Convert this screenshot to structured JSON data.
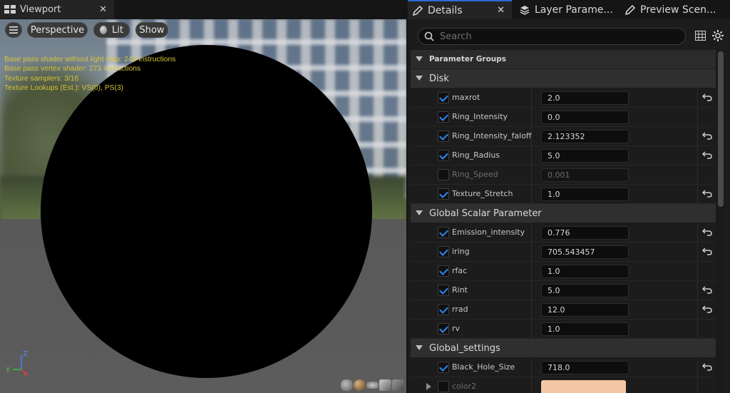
{
  "viewport": {
    "tab_label": "Viewport",
    "close_glyph": "✕",
    "toolbar": {
      "perspective_label": "Perspective",
      "lit_label": "Lit",
      "show_label": "Show"
    },
    "stats": [
      "Base pass shader without light map: 243 instructions",
      "Base pass vertex shader: 273 instructions",
      "Texture samplers: 3/16",
      "Texture Lookups (Est.): VS(0), PS(3)"
    ],
    "axis": {
      "z": "Z",
      "y": "Y",
      "x": "X"
    }
  },
  "details": {
    "tabs": [
      {
        "label": "Details",
        "active": true
      },
      {
        "label": "Layer Parame...",
        "active": false
      },
      {
        "label": "Preview Scen...",
        "active": false
      }
    ],
    "close_glyph": "✕",
    "search_placeholder": "Search",
    "header": "Parameter Groups",
    "groups": [
      {
        "name": "Disk",
        "params": [
          {
            "name": "maxrot",
            "value": "2.0",
            "checked": true,
            "reset": true
          },
          {
            "name": "Ring_Intensity",
            "value": "0.0",
            "checked": true,
            "reset": false
          },
          {
            "name": "Ring_Intensity_faloff",
            "value": "2.123352",
            "checked": true,
            "reset": true
          },
          {
            "name": "Ring_Radius",
            "value": "5.0",
            "checked": true,
            "reset": true
          },
          {
            "name": "Ring_Speed",
            "value": "0.001",
            "checked": false,
            "reset": false
          },
          {
            "name": "Texture_Stretch",
            "value": "1.0",
            "checked": true,
            "reset": true
          }
        ]
      },
      {
        "name": "Global Scalar Parameter",
        "params": [
          {
            "name": "Emission_intensity",
            "value": "0.776",
            "checked": true,
            "reset": true
          },
          {
            "name": "iring",
            "value": "705.543457",
            "checked": true,
            "reset": true
          },
          {
            "name": "rfac",
            "value": "1.0",
            "checked": true,
            "reset": false
          },
          {
            "name": "Rint",
            "value": "5.0",
            "checked": true,
            "reset": true
          },
          {
            "name": "rrad",
            "value": "12.0",
            "checked": true,
            "reset": true
          },
          {
            "name": "rv",
            "value": "1.0",
            "checked": true,
            "reset": false
          }
        ]
      },
      {
        "name": "Global_settings",
        "params": [
          {
            "name": "Black_Hole_Size",
            "value": "718.0",
            "checked": true,
            "reset": true
          },
          {
            "name": "color2",
            "value": "",
            "checked": false,
            "reset": false,
            "color": "#f5c6a5"
          }
        ]
      }
    ]
  },
  "colors": {
    "accent": "#2a6ad6",
    "checkbox": "#2f86f0",
    "stats_text": "#d5c33a"
  }
}
